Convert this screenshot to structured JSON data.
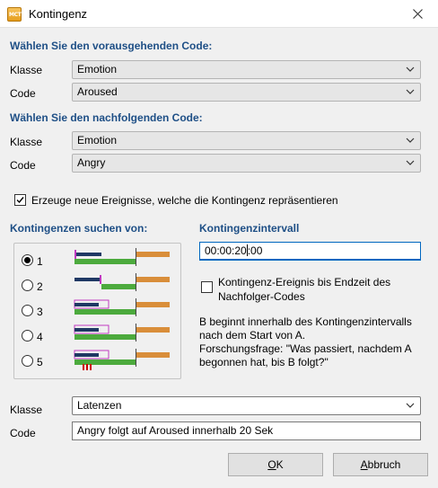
{
  "window": {
    "title": "Kontingenz",
    "icon": "app-icon",
    "close_icon": "close-icon"
  },
  "preceding": {
    "heading": "Wählen Sie den vorausgehenden Code:",
    "class_label": "Klasse",
    "class_value": "Emotion",
    "code_label": "Code",
    "code_value": "Aroused"
  },
  "following": {
    "heading": "Wählen Sie den nachfolgenden Code:",
    "class_label": "Klasse",
    "class_value": "Emotion",
    "code_label": "Code",
    "code_value": "Angry"
  },
  "create_events": {
    "label": "Erzeuge neue Ereignisse, welche die Kontingenz repräsentieren",
    "checked": true
  },
  "search": {
    "heading": "Kontingenzen suchen von:",
    "options": [
      {
        "label": "1",
        "selected": true
      },
      {
        "label": "2",
        "selected": false
      },
      {
        "label": "3",
        "selected": false
      },
      {
        "label": "4",
        "selected": false
      },
      {
        "label": "5",
        "selected": false
      }
    ]
  },
  "interval": {
    "heading": "Kontingenzintervall",
    "value_before_caret": "00:00:20",
    "value_after_caret": ":00",
    "end_time_label_1": "Kontingenz-Ereignis bis Endzeit des",
    "end_time_label_2": "Nachfolger-Codes",
    "end_time_checked": false,
    "desc_1": "B beginnt innerhalb des Kontingenzintervalls",
    "desc_2": "nach dem Start von A.",
    "desc_3": "Forschungsfrage: \"Was passiert, nachdem A",
    "desc_4": "begonnen hat, bis B folgt?\""
  },
  "result": {
    "class_label": "Klasse",
    "class_value": "Latenzen",
    "code_label": "Code",
    "code_value": "Angry folgt auf Aroused innerhalb 20 Sek"
  },
  "buttons": {
    "ok_mnemonic": "O",
    "ok_rest": "K",
    "cancel_mnemonic": "A",
    "cancel_rest": "bbruch"
  },
  "colors": {
    "heading": "#1e4f86",
    "navy": "#1f3864",
    "orange": "#d98e3a",
    "green": "#4caa3d",
    "magenta": "#c03ac0",
    "red": "#cc0000"
  }
}
